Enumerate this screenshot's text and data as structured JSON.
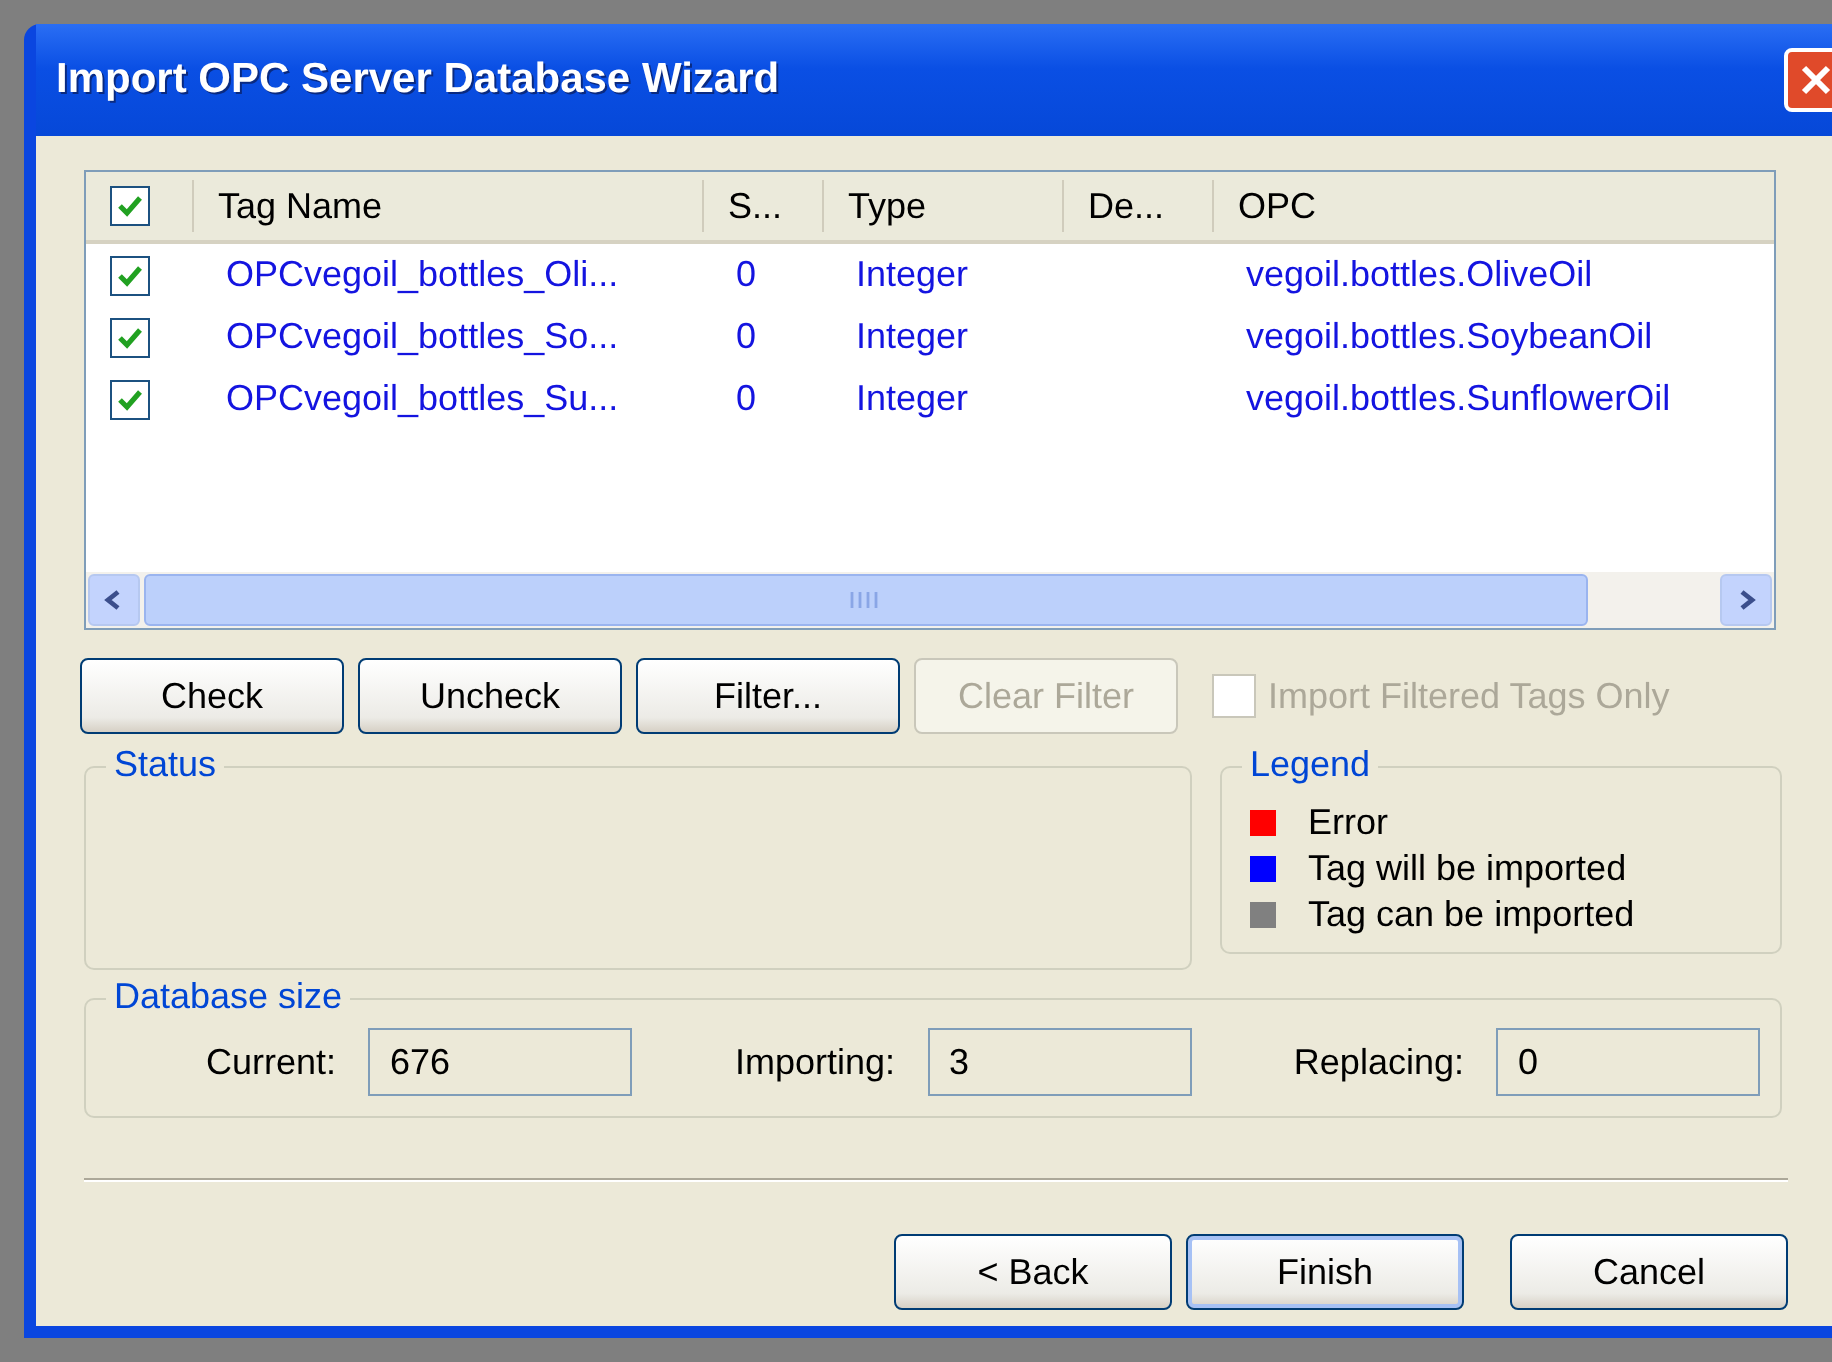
{
  "window": {
    "title": "Import OPC Server Database Wizard"
  },
  "table": {
    "header_checked": true,
    "columns": [
      "Tag Name",
      "S...",
      "Type",
      "De...",
      "OPC"
    ],
    "rows": [
      {
        "checked": true,
        "tag_name": "OPCvegoil_bottles_Oli...",
        "s": "0",
        "type": "Integer",
        "opc": "vegoil.bottles.OliveOil"
      },
      {
        "checked": true,
        "tag_name": "OPCvegoil_bottles_So...",
        "s": "0",
        "type": "Integer",
        "opc": "vegoil.bottles.SoybeanOil"
      },
      {
        "checked": true,
        "tag_name": "OPCvegoil_bottles_Su...",
        "s": "0",
        "type": "Integer",
        "opc": "vegoil.bottles.SunflowerOil"
      }
    ]
  },
  "actions": [
    {
      "label": "Check",
      "disabled": false
    },
    {
      "label": "Uncheck",
      "disabled": false
    },
    {
      "label": "Filter...",
      "disabled": false
    },
    {
      "label": "Clear Filter",
      "disabled": true
    }
  ],
  "import_filtered": {
    "label": "Import Filtered Tags Only",
    "checked": false,
    "disabled": true
  },
  "status": {
    "title": "Status"
  },
  "legend": {
    "title": "Legend",
    "items": [
      {
        "label": "Error",
        "color": "#ff0000"
      },
      {
        "label": "Tag will be imported",
        "color": "#0000ff"
      },
      {
        "label": "Tag can be imported",
        "color": "#808080"
      }
    ]
  },
  "database_size": {
    "title": "Database size",
    "fields": [
      {
        "label": "Current:",
        "value": "676"
      },
      {
        "label": "Importing:",
        "value": "3"
      },
      {
        "label": "Replacing:",
        "value": "0"
      }
    ]
  },
  "buttons": [
    {
      "label": "< Back",
      "selected": false
    },
    {
      "label": "Finish",
      "selected": true
    },
    {
      "label": "Cancel",
      "selected": false
    }
  ]
}
